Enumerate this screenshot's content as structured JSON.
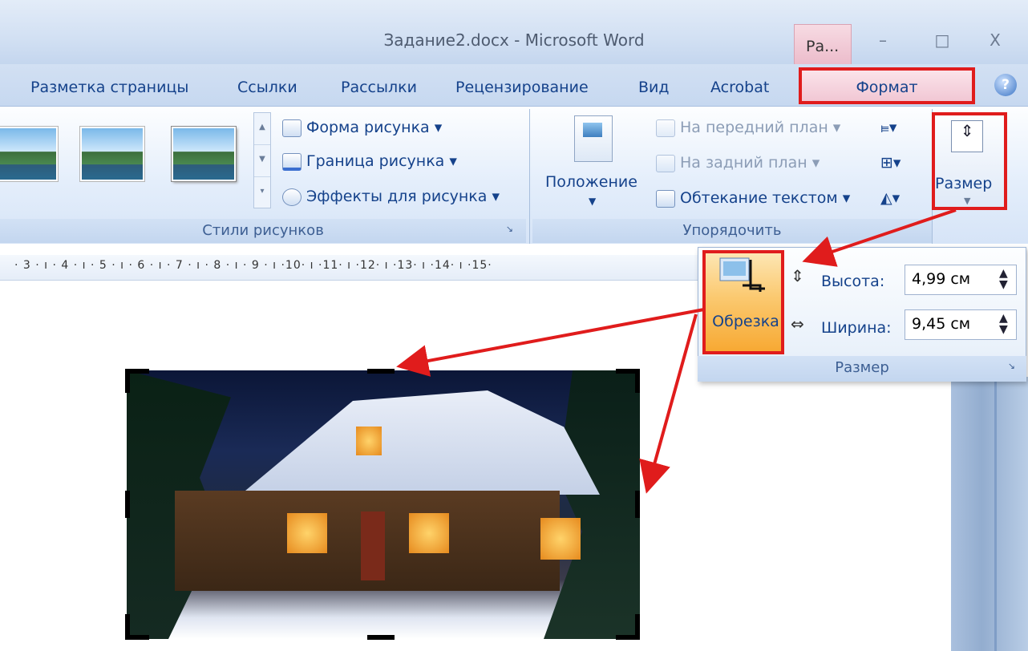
{
  "window": {
    "title": "Задание2.docx - Microsoft Word",
    "context_tab": "Ра...",
    "minimize": "–",
    "maximize": "□",
    "close": "X"
  },
  "tabs": [
    "Разметка страницы",
    "Ссылки",
    "Рассылки",
    "Рецензирование",
    "Вид",
    "Acrobat",
    "Формат"
  ],
  "help": "?",
  "picture_styles_group": {
    "label": "Стили рисунков",
    "buttons": [
      "Форма рисунка",
      "Граница рисунка",
      "Эффекты для рисунка"
    ]
  },
  "arrange_group": {
    "label": "Упорядочить",
    "position": "Положение",
    "bring_front": "На передний план",
    "send_back": "На задний план",
    "text_wrap": "Обтекание текстом"
  },
  "size_group": {
    "button": "Размер"
  },
  "ruler": "· 3 · ı · 4 · ı · 5 · ı · 6 · ı · 7 · ı · 8 · ı · 9 · ı ·10· ı ·11· ı ·12· ı ·13· ı ·14· ı ·15·",
  "size_popup": {
    "crop": "Обрезка",
    "height_label": "Высота:",
    "height_value": "4,99 см",
    "width_label": "Ширина:",
    "width_value": "9,45 см",
    "label": "Размер"
  },
  "colors": {
    "highlight_red": "#e01c1c",
    "ribbon_text": "#15428b",
    "crop_orange": "#f7a933"
  },
  "icons": [
    "shape-icon",
    "border-icon",
    "effects-icon",
    "position-icon",
    "bring-front-icon",
    "send-back-icon",
    "text-wrap-icon",
    "align-icon",
    "group-icon",
    "rotate-icon",
    "size-icon",
    "crop-icon",
    "height-icon",
    "width-icon",
    "help-icon"
  ]
}
